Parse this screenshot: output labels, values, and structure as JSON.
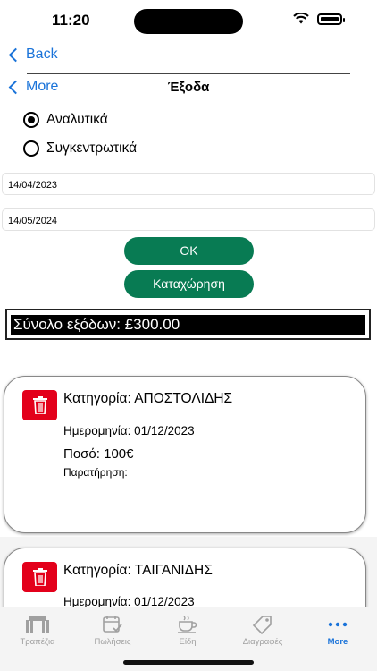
{
  "status": {
    "time": "11:20"
  },
  "nav": {
    "back_label": "Back",
    "more_label": "More",
    "title": "Έξοδα"
  },
  "filters": {
    "options": [
      {
        "label": "Αναλυτικά",
        "checked": true
      },
      {
        "label": "Συγκεντρωτικά",
        "checked": false
      }
    ],
    "date_from": "14/04/2023",
    "date_to": "14/05/2024"
  },
  "buttons": {
    "ok": "OK",
    "register": "Καταχώρηση"
  },
  "total": "Σύνολο εξόδων: £300.00",
  "expenses": [
    {
      "category": "Κατηγορία: ΑΠΟΣΤΟΛΙΔΗΣ",
      "date": "Ημερομηνία: 01/12/2023",
      "amount": "Ποσό: 100€",
      "note": "Παρατήρηση:"
    },
    {
      "category": "Κατηγορία: ΤΑΙΓΑΝΙΔΗΣ",
      "date": "Ημερομηνία: 01/12/2023"
    }
  ],
  "tabs": [
    {
      "label": "Τραπέζια",
      "icon": "table-icon",
      "active": false
    },
    {
      "label": "Πωλήσεις",
      "icon": "calendar-check-icon",
      "active": false
    },
    {
      "label": "Είδη",
      "icon": "coffee-cup-icon",
      "active": false
    },
    {
      "label": "Διαγραφές",
      "icon": "tag-icon",
      "active": false
    },
    {
      "label": "More",
      "icon": "more-dots-icon",
      "active": true
    }
  ],
  "colors": {
    "accent": "#1a73d9",
    "button_green": "#087b53",
    "delete_red": "#e3001b"
  }
}
